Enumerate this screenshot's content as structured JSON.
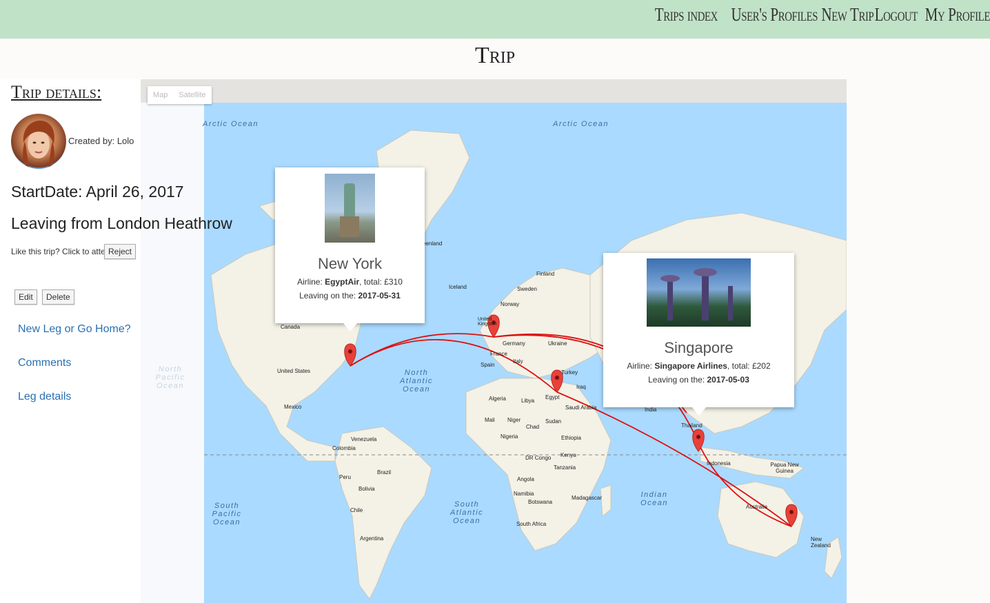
{
  "nav": {
    "items": [
      "Trips index",
      "User's Profiles",
      "New Trip",
      "Logout",
      "My Profile"
    ]
  },
  "page_title": "Trip",
  "sidebar": {
    "heading": "Trip details:",
    "created_by": "Created by: Lolo",
    "start_date": "StartDate: April 26, 2017",
    "leaving_from": "Leaving from London Heathrow",
    "like_text": "Like this trip? Click to attend:",
    "reject_label": "Reject",
    "edit_label": "Edit",
    "delete_label": "Delete",
    "links": [
      "New Leg or Go Home?",
      "Comments",
      "Leg details"
    ]
  },
  "map": {
    "type_buttons": [
      "Map",
      "Satellite"
    ],
    "oceans": [
      "Arctic Ocean",
      "Arctic Ocean",
      "North Atlantic Ocean",
      "South Atlantic Ocean",
      "South Pacific Ocean",
      "Indian Ocean",
      "North Pacific Ocean"
    ],
    "places": [
      "Canada",
      "United States",
      "Mexico",
      "Venezuela",
      "Colombia",
      "Peru",
      "Brazil",
      "Bolivia",
      "Chile",
      "Argentina",
      "Iceland",
      "Finland",
      "Sweden",
      "Norway",
      "United Kingdom",
      "Germany",
      "Ukraine",
      "France",
      "Spain",
      "Italy",
      "Turkey",
      "Algeria",
      "Libya",
      "Egypt",
      "Mali",
      "Niger",
      "Chad",
      "Sudan",
      "Nigeria",
      "Ethiopia",
      "DR Congo",
      "Kenya",
      "Tanzania",
      "Angola",
      "Namibia",
      "Botswana",
      "South Africa",
      "Madagascar",
      "Saudi Arabia",
      "Iraq",
      "India",
      "Thailand",
      "Indonesia",
      "Papua New Guinea",
      "Australia",
      "New Zealand",
      "Greenland"
    ],
    "route_color": "#dd1111",
    "marker_color": "#e8413a"
  },
  "popups": {
    "new_york": {
      "title": "New York",
      "airline_prefix": "Airline: ",
      "airline": "EgyptAir",
      "total": ", total: £310",
      "leaving_prefix": "Leaving on the: ",
      "date": "2017-05-31"
    },
    "singapore": {
      "title": "Singapore",
      "airline_prefix": "Airline: ",
      "airline": "Singapore Airlines",
      "total": ", total: £202",
      "leaving_prefix": "Leaving on the: ",
      "date": "2017-05-03"
    }
  }
}
